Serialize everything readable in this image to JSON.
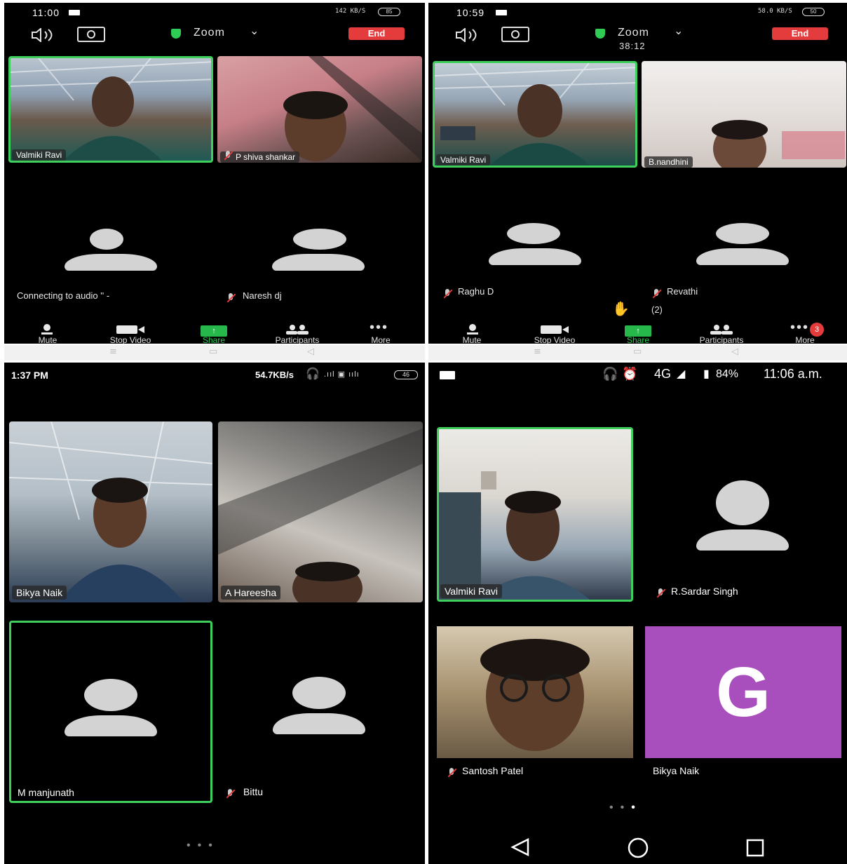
{
  "screen_top_left": {
    "status_time": "11:00",
    "status_right": "142 KB/S",
    "battery": "85",
    "app_title": "Zoom",
    "end_label": "End",
    "tiles": [
      {
        "name": "Valmiki Ravi",
        "active": true,
        "muted": false
      },
      {
        "name": "P shiva shankar",
        "active": false,
        "muted": true
      }
    ],
    "avatars": [
      {
        "name": "Connecting to audio '' -",
        "muted": false
      },
      {
        "name": "Naresh dj",
        "muted": true
      }
    ],
    "toolbar": {
      "mute": "Mute",
      "stop_video": "Stop Video",
      "share": "Share",
      "participants": "Participants",
      "more": "More"
    }
  },
  "screen_top_right": {
    "status_time": "10:59",
    "status_right": "58.0 KB/S",
    "battery": "50",
    "app_title": "Zoom",
    "meeting_timer": "38:12",
    "end_label": "End",
    "tiles": [
      {
        "name": "Valmiki Ravi",
        "active": true,
        "muted": false
      },
      {
        "name": "B.nandhini",
        "active": false,
        "muted": false
      }
    ],
    "avatars": [
      {
        "name": "Raghu D",
        "muted": true
      },
      {
        "name": "Revathi",
        "muted": true
      }
    ],
    "raised_hands": "(2)",
    "more_badge": "3",
    "toolbar": {
      "mute": "Mute",
      "stop_video": "Stop Video",
      "share": "Share",
      "participants": "Participants",
      "more": "More"
    }
  },
  "screen_bottom_left": {
    "status_time": "1:37 PM",
    "status_right": "54.7KB/s",
    "battery": "46",
    "tiles": [
      {
        "name": "Bikya Naik",
        "active": false
      },
      {
        "name": "A Hareesha",
        "active": false
      }
    ],
    "avatars": [
      {
        "name": "M manjunath",
        "active": true,
        "muted": false
      },
      {
        "name": "Bittu",
        "active": false,
        "muted": true
      }
    ]
  },
  "screen_bottom_right": {
    "status_right": "4G",
    "battery_percent": "84%",
    "status_time": "11:06 a.m.",
    "tiles": [
      {
        "name": "Valmiki Ravi",
        "active": true
      },
      {
        "name": "R.Sardar Singh",
        "muted": true
      },
      {
        "name": "Santosh Patel",
        "muted": true
      },
      {
        "name": "Bikya Naik",
        "letter": "G"
      }
    ]
  },
  "colors": {
    "active_border": "#3ecf5c",
    "end_button": "#e43c3c",
    "share_green": "#27b84b",
    "avatar_gray": "#d3d3d3",
    "letter_tile": "#a94fbd"
  }
}
